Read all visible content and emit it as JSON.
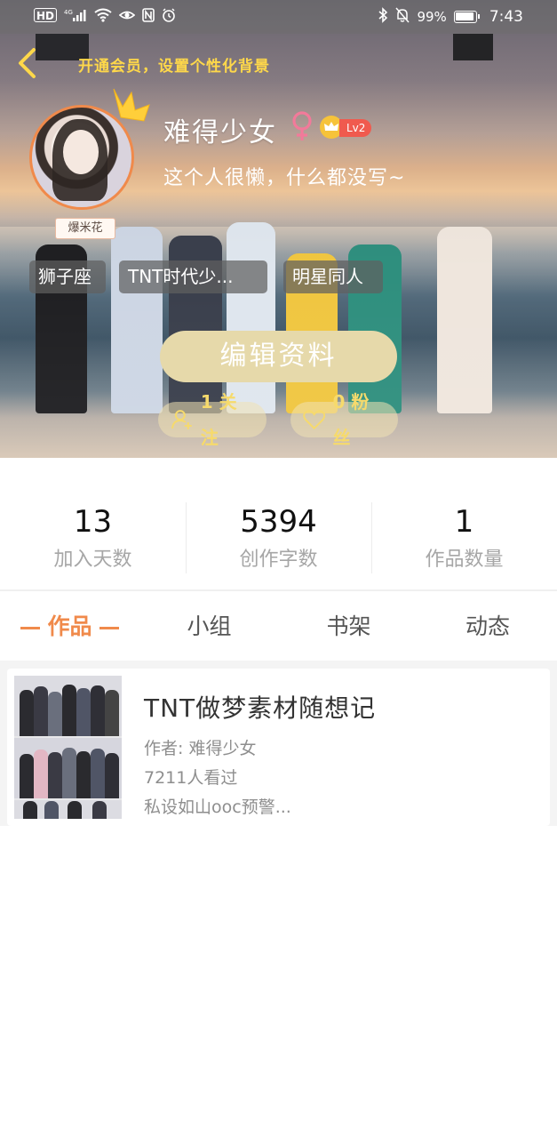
{
  "status_bar": {
    "hd": "HD",
    "signal": "4G",
    "battery_percent": "99%",
    "time": "7:43"
  },
  "header": {
    "promo_text": "开通会员，设置个性化背景"
  },
  "profile": {
    "badge": "爆米花",
    "username": "难得少女",
    "level": "Lv2",
    "bio": "这个人很懒，什么都没写~",
    "tags": [
      "狮子座",
      "TNT时代少...",
      "明星同人"
    ],
    "edit_button": "编辑资料",
    "following": "1 关注",
    "followers": "0 粉丝"
  },
  "stats": [
    {
      "value": "13",
      "label": "加入天数"
    },
    {
      "value": "5394",
      "label": "创作字数"
    },
    {
      "value": "1",
      "label": "作品数量"
    }
  ],
  "tabs": [
    {
      "label": "作品",
      "active": true
    },
    {
      "label": "小组",
      "active": false
    },
    {
      "label": "书架",
      "active": false
    },
    {
      "label": "动态",
      "active": false
    }
  ],
  "works": [
    {
      "title": "TNT做梦素材随想记",
      "author": "作者: 难得少女",
      "views": "7211人看过",
      "intro": "私设如山ooc预警..."
    }
  ],
  "colors": {
    "accent": "#f08a4b",
    "gold_text": "#ffd84a",
    "edit_button_bg": "#e6d9aa",
    "gender_female": "#f27a9a",
    "level_badge": "#f05a4e"
  }
}
